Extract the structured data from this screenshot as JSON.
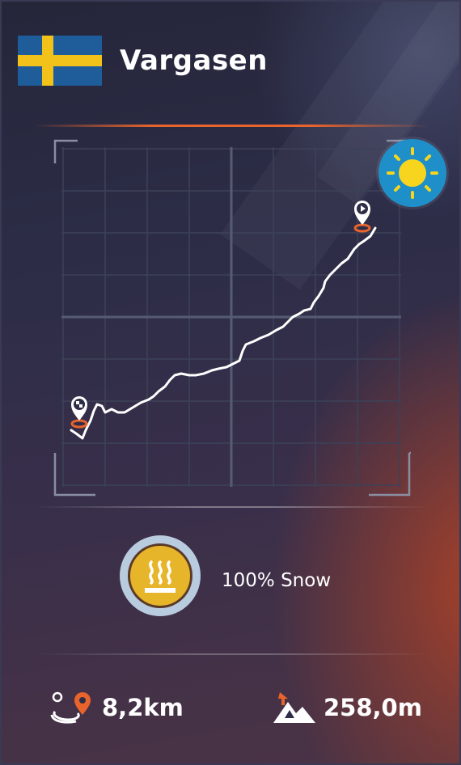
{
  "track": {
    "name": "Vargasen",
    "country_flag": "sweden-flag",
    "weather_icon": "sun-icon",
    "snow_icon": "heated-snow-icon",
    "snow_label": "100% Snow",
    "distance": "8,2km",
    "elevation": "258,0m",
    "distance_icon": "route-distance-icon",
    "elevation_icon": "mountain-elevation-icon",
    "start_icon": "start-marker-icon",
    "finish_icon": "finish-marker-icon"
  },
  "colors": {
    "accent": "#e8642c",
    "flag_blue": "#1f5c9a",
    "flag_yellow": "#f2c21a",
    "weather_bg": "#1f8fc9",
    "sun": "#f7d51e",
    "badge_gold": "#e7b52a"
  }
}
